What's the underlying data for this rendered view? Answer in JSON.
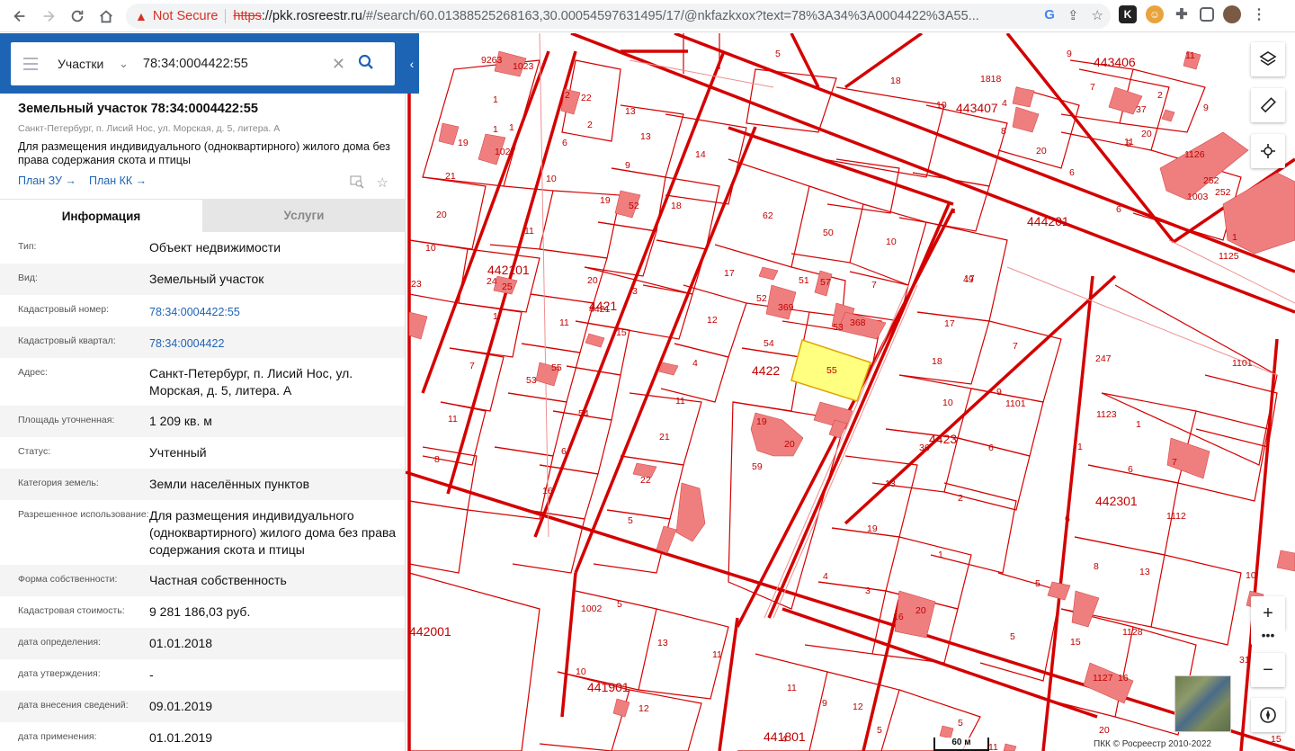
{
  "browser": {
    "security_label": "Not Secure",
    "url_scheme": "https",
    "url_host": "://pkk.rosreestr.ru",
    "url_rest": "/#/search/60.01388525268163,30.00054597631495/17/@nkfazkxox?text=78%3A34%3A0004422%3A55..."
  },
  "search": {
    "type_label": "Участки",
    "query": "78:34:0004422:55"
  },
  "parcel": {
    "title": "Земельный участок 78:34:0004422:55",
    "address_short": "Санкт-Петербург, п. Лисий Нос, ул. Морская, д. 5, литера. А",
    "purpose": "Для размещения индивидуального (одноквартирного) жилого дома без права содержания скота и птицы",
    "plan_zu_label": "План ЗУ →",
    "plan_kk_label": "План КК →"
  },
  "tabs": {
    "info": "Информация",
    "services": "Услуги"
  },
  "rows": [
    {
      "key": "Тип:",
      "value": "Объект недвижимости"
    },
    {
      "key": "Вид:",
      "value": "Земельный участок"
    },
    {
      "key": "Кадастровый номер:",
      "value": "78:34:0004422:55"
    },
    {
      "key": "Кадастровый квартал:",
      "value": "78:34:0004422"
    },
    {
      "key": "Адрес:",
      "value": "Санкт-Петербург, п. Лисий Нос, ул. Морская, д. 5, литера. А"
    },
    {
      "key": "Площадь уточненная:",
      "value": "1 209 кв. м"
    },
    {
      "key": "Статус:",
      "value": "Учтенный"
    },
    {
      "key": "Категория земель:",
      "value": "Земли населённых пунктов"
    },
    {
      "key": "Разрешенное использование:",
      "value": "Для размещения индивидуального (одноквартирного) жилого дома без права содержания скота и птицы"
    },
    {
      "key": "Форма собственности:",
      "value": "Частная собственность"
    },
    {
      "key": "Кадастровая стоимость:",
      "value": "9 281 186,03 руб."
    },
    {
      "key": "дата определения:",
      "value": "01.01.2018"
    },
    {
      "key": "дата утверждения:",
      "value": "-"
    },
    {
      "key": "дата внесения сведений:",
      "value": "09.01.2019"
    },
    {
      "key": "дата применения:",
      "value": "01.01.2019"
    }
  ],
  "map": {
    "scale_label": "60 м",
    "copyright": "ПКК © Росреестр 2010-2022",
    "quarter_labels": [
      "442101",
      "4421",
      "4422",
      "4423",
      "442301",
      "442001",
      "441901",
      "441801",
      "443406",
      "443407",
      "444201"
    ],
    "parcel_labels": [
      "5",
      "1",
      "2",
      "2",
      "22",
      "1023",
      "9263",
      "1",
      "1",
      "19",
      "1027",
      "6",
      "10",
      "21",
      "20",
      "10",
      "11",
      "24",
      "25",
      "23",
      "1",
      "7",
      "11",
      "8",
      "53",
      "55",
      "11",
      "3",
      "4421",
      "15",
      "17",
      "20",
      "18",
      "19",
      "52",
      "9",
      "13",
      "13",
      "14",
      "62",
      "50",
      "10",
      "17",
      "51",
      "57",
      "7",
      "52",
      "369",
      "12",
      "53",
      "368",
      "54",
      "55",
      "4",
      "11",
      "21",
      "22",
      "54",
      "6",
      "16",
      "5",
      "19",
      "20",
      "59",
      "49",
      "17",
      "7",
      "18",
      "9",
      "10",
      "36",
      "6",
      "13",
      "2",
      "19",
      "1",
      "4",
      "3",
      "16",
      "20",
      "247",
      "1101",
      "1101",
      "1123",
      "1",
      "1",
      "6",
      "7",
      "1112",
      "6",
      "8",
      "13",
      "5",
      "5",
      "15",
      "16",
      "1127",
      "1128",
      "1125",
      "1126",
      "1",
      "252",
      "1003",
      "252",
      "18",
      "1818",
      "10",
      "4",
      "8",
      "20",
      "6",
      "7",
      "9",
      "5",
      "2",
      "11",
      "37",
      "20",
      "11",
      "9",
      "6",
      "1002",
      "5",
      "13",
      "11",
      "10",
      "12",
      "11",
      "9",
      "12",
      "5",
      "11",
      "5",
      "4",
      "31",
      "15",
      "10",
      "20"
    ],
    "highlight_color": "#ffff80",
    "boundary_color": "#d40000",
    "building_color": "#ef7f7f"
  },
  "icons": {
    "layers": "layers-icon",
    "ruler": "ruler-icon",
    "locate": "crosshair-icon",
    "zoom_in": "plus-icon",
    "zoom_out": "minus-icon",
    "more": "more-icon",
    "compass": "compass-icon"
  }
}
